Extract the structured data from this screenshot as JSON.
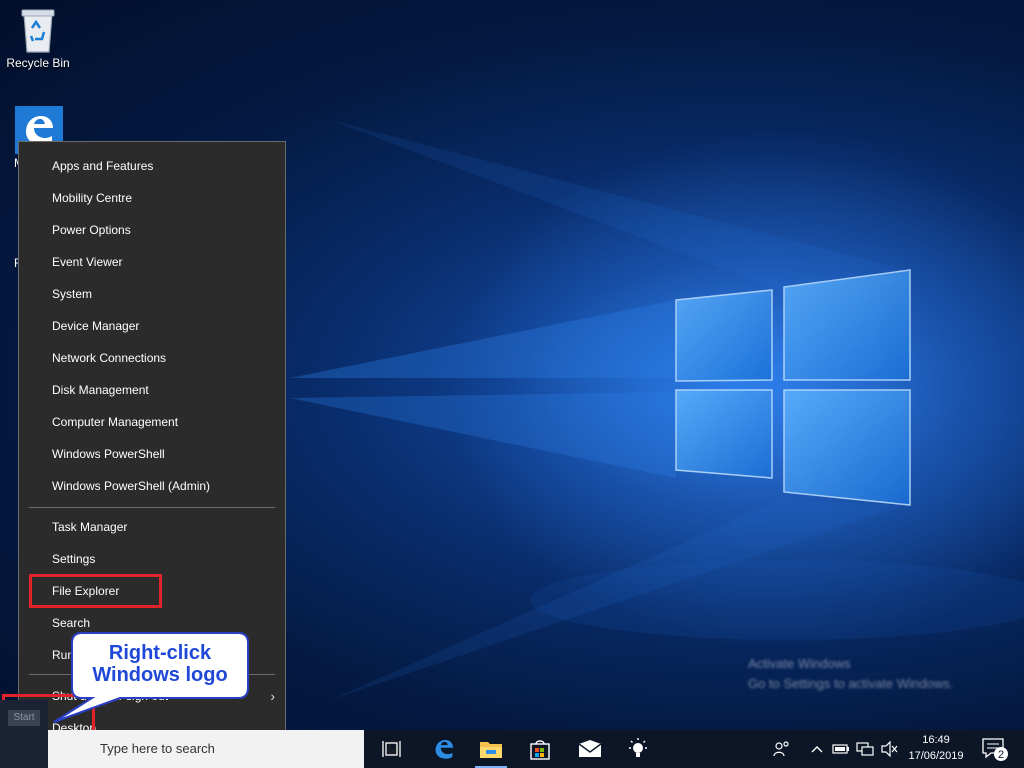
{
  "desktop": {
    "recycle_bin_label": "Recycle Bin",
    "stub_a": "M",
    "stub_b": "F"
  },
  "menu": {
    "items": [
      {
        "label": "Apps and Features"
      },
      {
        "label": "Mobility Centre"
      },
      {
        "label": "Power Options"
      },
      {
        "label": "Event Viewer"
      },
      {
        "label": "System"
      },
      {
        "label": "Device Manager"
      },
      {
        "label": "Network Connections"
      },
      {
        "label": "Disk Management"
      },
      {
        "label": "Computer Management"
      },
      {
        "label": "Windows PowerShell"
      },
      {
        "label": "Windows PowerShell (Admin)"
      },
      {
        "label": "Task Manager"
      },
      {
        "label": "Settings"
      },
      {
        "label": "File Explorer"
      },
      {
        "label": "Search"
      },
      {
        "label": "Run"
      },
      {
        "label": "Shut down or sign out"
      },
      {
        "label": "Desktop"
      }
    ],
    "submenu_arrow": "›"
  },
  "callout": {
    "line1": "Right-click",
    "line2": "Windows logo"
  },
  "taskbar": {
    "start_label": "Start",
    "search_placeholder": "Type here to search",
    "clock_time": "16:49",
    "clock_date": "17/06/2019",
    "notification_count": "2"
  },
  "watermark": {
    "line1": "Activate Windows",
    "line2": "Go to Settings to activate Windows."
  },
  "colors": {
    "highlight": "#e3232b",
    "callout_text": "#1f48d8",
    "menu_bg": "#2b2b2b"
  }
}
